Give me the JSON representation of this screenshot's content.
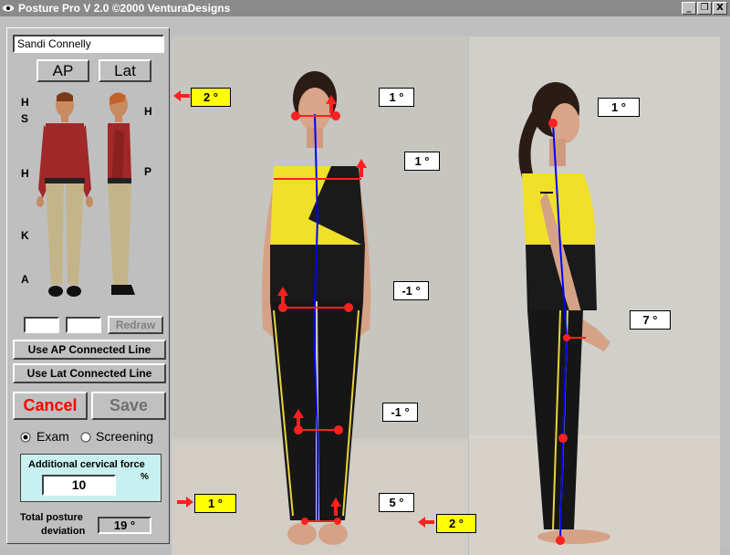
{
  "window": {
    "title": "Posture Pro V 2.0 ©2000 VenturaDesigns",
    "controls": [
      "_",
      "❐",
      "X"
    ]
  },
  "patient": {
    "name": "Sandi Connelly"
  },
  "view_buttons": {
    "ap": "AP",
    "lat": "Lat"
  },
  "ap_figure_markers": [
    "H",
    "S",
    "H",
    "K",
    "A"
  ],
  "lat_figure_markers": [
    "H",
    "P"
  ],
  "redraw_label": "Redraw",
  "use_ap_line": "Use AP Connected Line",
  "use_lat_line": "Use Lat Connected Line",
  "cancel_label": "Cancel",
  "save_label": "Save",
  "mode": {
    "exam_label": "Exam",
    "screening_label": "Screening",
    "selected": "Exam"
  },
  "cervical": {
    "label": "Additional cervical force",
    "value": "10",
    "unit": "%"
  },
  "total": {
    "label_line1": "Total posture",
    "label_line2": "deviation",
    "value": "19 °"
  },
  "ap_angles": {
    "head_side": "2 °",
    "head": "1 °",
    "shoulder": "1 °",
    "pelvis": "-1 °",
    "knee": "-1 °",
    "ankle": "5 °",
    "foot_left": "1 °"
  },
  "lat_angles": {
    "head": "1 °",
    "hip": "7 °",
    "foot": "2 °"
  },
  "colors": {
    "cancel_text": "#ff0000",
    "save_text": "#707070",
    "cervical_box": "#c8f0f0",
    "highlight": "#ffff00",
    "marker": "#ff2020",
    "plumb_line": "#0000ff"
  }
}
